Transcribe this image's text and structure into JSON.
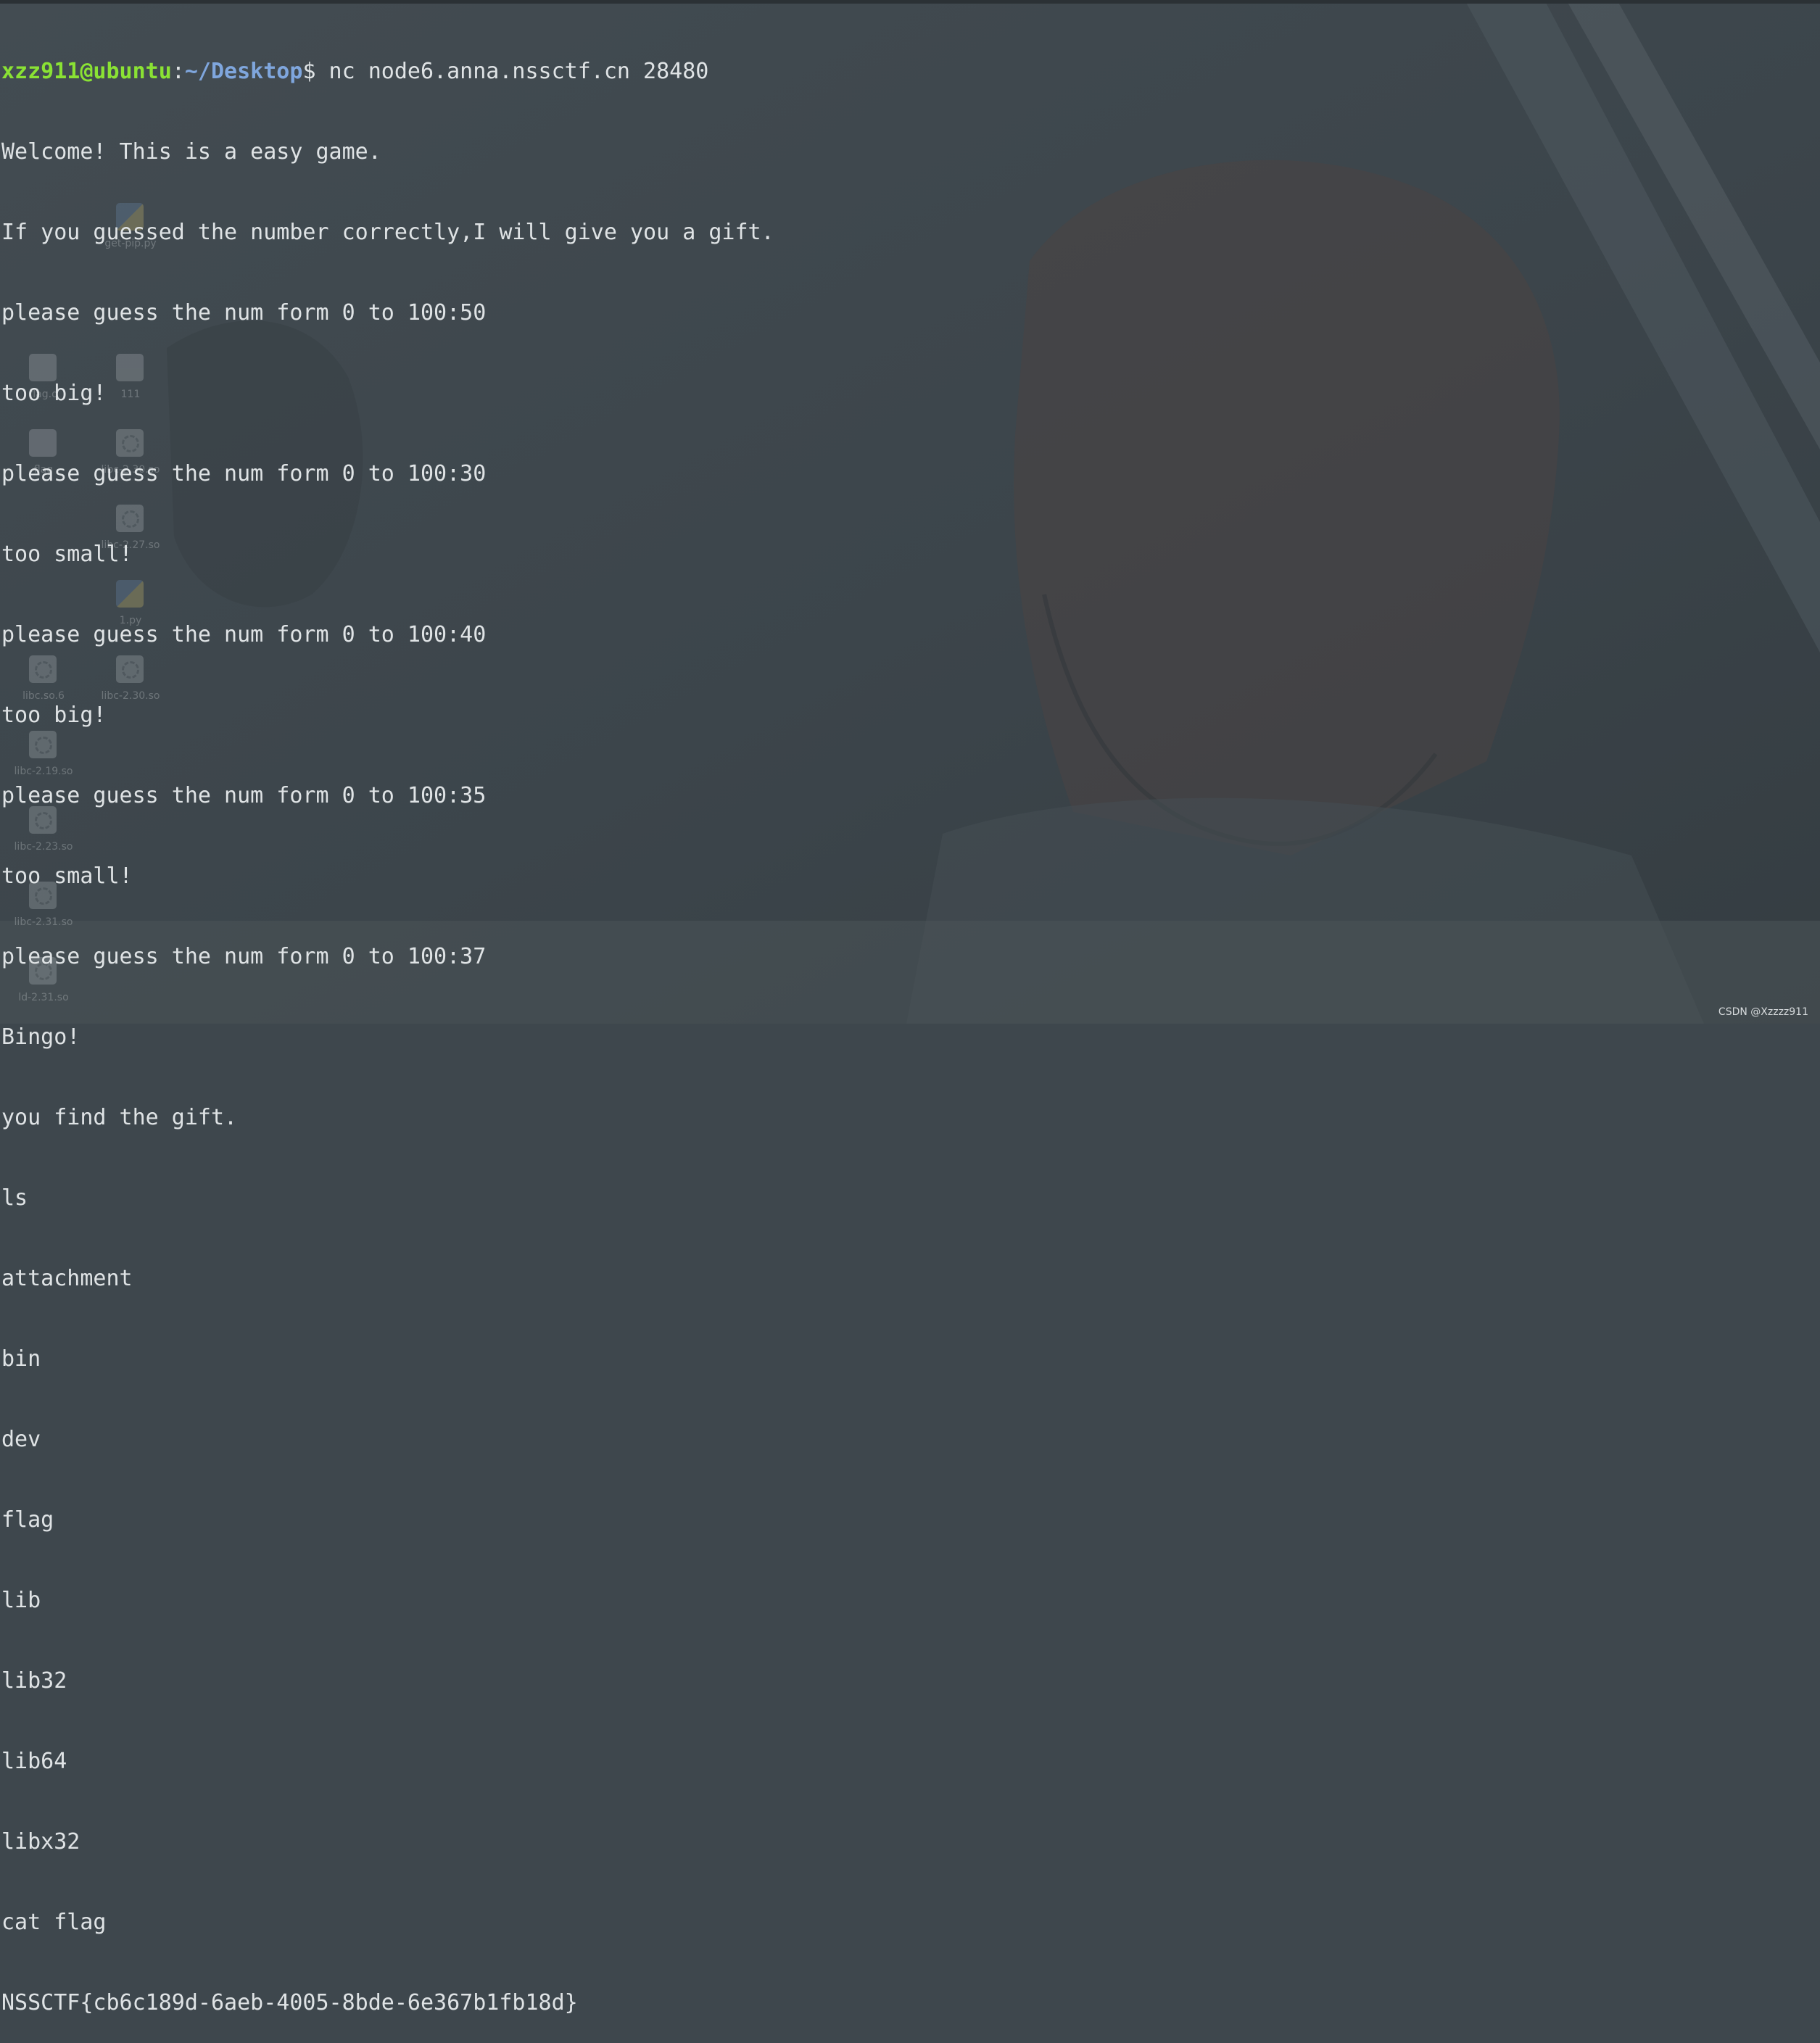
{
  "prompt": {
    "user_host": "xzz911@ubuntu",
    "path": "~/Desktop",
    "symbol": "$",
    "command": " nc node6.anna.nssctf.cn 28480"
  },
  "terminal_lines": [
    "Welcome! This is a easy game.",
    "If you guessed the number correctly,I will give you a gift.",
    "please guess the num form 0 to 100:50",
    "too big!",
    "please guess the num form 0 to 100:30",
    "too small!",
    "please guess the num form 0 to 100:40",
    "too big!",
    "please guess the num form 0 to 100:35",
    "too small!",
    "please guess the num form 0 to 100:37",
    "Bingo!",
    "you find the gift.",
    "ls",
    "attachment",
    "bin",
    "dev",
    "flag",
    "lib",
    "lib32",
    "lib64",
    "libx32",
    "cat flag",
    "NSSCTF{cb6c189d-6aeb-4005-8bde-6e367b1fb18d}"
  ],
  "desktop_icons": [
    {
      "label": "get-pip.py",
      "icon": "python-file-icon"
    },
    {
      "label": "111",
      "icon": "file-icon"
    },
    {
      "label": "flag.o",
      "icon": "file-icon"
    },
    {
      "label": "flag",
      "icon": "file-icon"
    },
    {
      "label": "libc-2.30.so",
      "icon": "library-gear-icon"
    },
    {
      "label": "libc-2.27.so",
      "icon": "library-gear-icon"
    },
    {
      "label": "1.py",
      "icon": "python-file-icon"
    },
    {
      "label": "libc.so.6",
      "icon": "library-gear-icon"
    },
    {
      "label": "libc-2.30.so",
      "icon": "library-gear-icon"
    },
    {
      "label": "libc-2.19.so",
      "icon": "library-gear-icon"
    },
    {
      "label": "libc-2.23.so",
      "icon": "library-gear-icon"
    },
    {
      "label": "libc-2.31.so",
      "icon": "library-gear-icon"
    },
    {
      "label": "ld-2.31.so",
      "icon": "library-gear-icon"
    }
  ],
  "watermark": "CSDN @Xzzzz911",
  "colors": {
    "prompt_user": "#8ae234",
    "prompt_path": "#7fa6dd",
    "text": "#dfe3e5",
    "background": "#3e474d"
  }
}
